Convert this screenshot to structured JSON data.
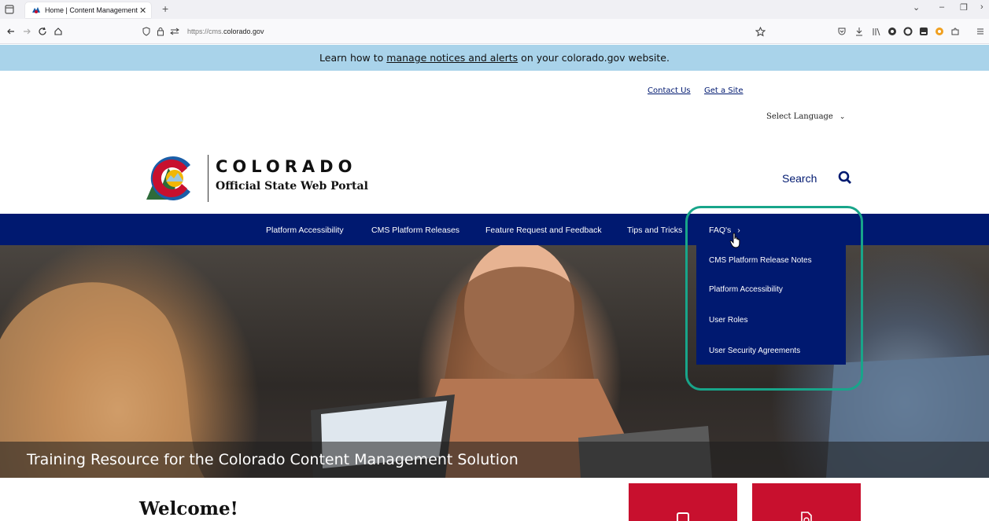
{
  "browser": {
    "tab_title": "Home | Content Management",
    "tab_close": "✕",
    "new_tab": "+",
    "url_prefix": "https://cms.",
    "url_domain": "colorado.gov"
  },
  "site": {
    "alert": {
      "before": "Learn how to",
      "link": "manage notices and alerts",
      "after": "on your colorado.gov website."
    },
    "utility_links": [
      "Contact Us",
      "Get a Site"
    ],
    "language_select": "Select Language",
    "logo": {
      "wordmark": "COLORADO",
      "tagline": "Official State Web Portal"
    },
    "search_label": "Search",
    "main_nav": [
      "Platform Accessibility",
      "CMS Platform Releases",
      "Feature Request and Feedback",
      "Tips and Tricks",
      "FAQ's"
    ],
    "faq_dropdown": [
      "CMS Platform Release Notes",
      "Platform Accessibility",
      "User Roles",
      "User Security Agreements"
    ],
    "hero_caption": "Training Resource for the Colorado Content Management Solution",
    "welcome_heading": "Welcome!"
  },
  "colors": {
    "nav_blue": "#001970",
    "banner_blue": "#a9d3ea",
    "highlight_green": "#18a58a",
    "card_red": "#c8102e"
  }
}
